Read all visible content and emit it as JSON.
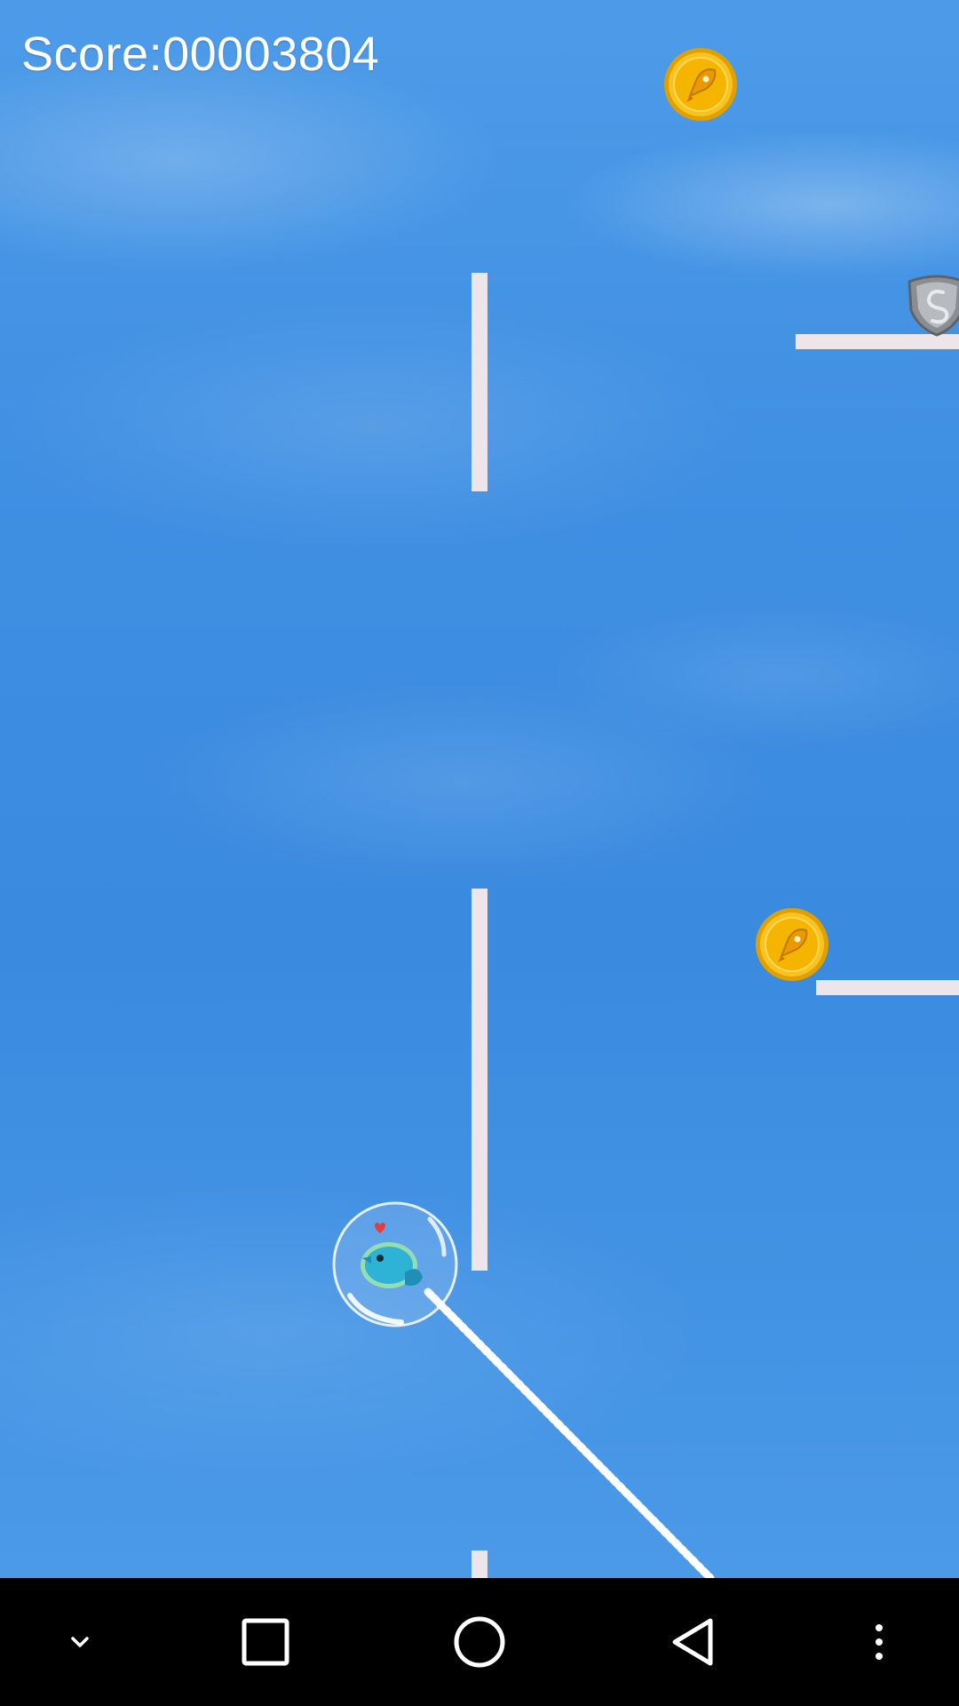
{
  "hud": {
    "score_label": "Score:00003804"
  },
  "colors": {
    "sky": "#3f8fe3",
    "platform": "#ece6ea",
    "coin": "#f5b800",
    "score_text": "#ffffff",
    "navbar": "#000000"
  },
  "icons": {
    "coins": [
      "rocket-coin-icon",
      "rocket-coin-icon"
    ],
    "powerup": "shield-icon",
    "player": "bird-in-bubble-icon"
  },
  "navbar": {
    "buttons": [
      "chevron-down-icon",
      "recents-square-icon",
      "home-circle-icon",
      "back-triangle-icon",
      "more-vert-icon"
    ]
  }
}
